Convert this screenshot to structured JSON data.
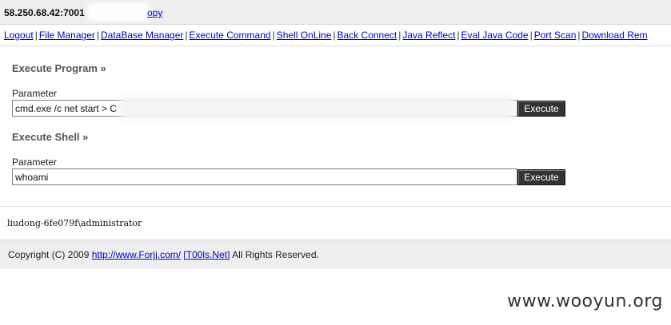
{
  "header": {
    "host": "58.250.68.42:7001",
    "copy_link": "opy"
  },
  "nav": {
    "items": [
      "Logout",
      "File Manager",
      "DataBase Manager",
      "Execute Command",
      "Shell OnLine",
      "Back Connect",
      "Java Reflect",
      "Eval Java Code",
      "Port Scan",
      "Download Rem"
    ],
    "separator": "|"
  },
  "execute_program": {
    "title": "Execute Program »",
    "param_label": "Parameter",
    "value": "cmd.exe /c net start > C",
    "button": "Execute"
  },
  "execute_shell": {
    "title": "Execute Shell »",
    "param_label": "Parameter",
    "value": "whoami",
    "button": "Execute"
  },
  "output": {
    "text": "liudong-6fe079f\\administrator"
  },
  "footer": {
    "prefix": "Copyright (C) 2009 ",
    "link1": "http://www.Forjj.com/",
    "link2": "[T00ls.Net]",
    "suffix": " All Rights Reserved."
  },
  "watermark": "www.wooyun.org"
}
